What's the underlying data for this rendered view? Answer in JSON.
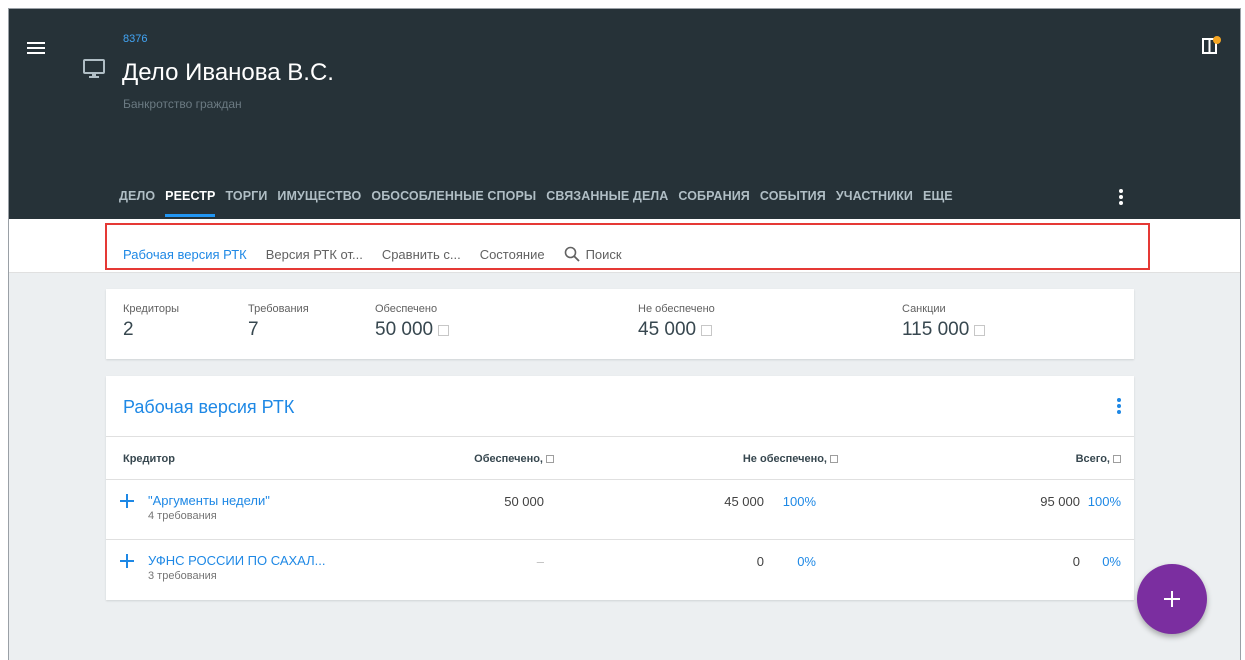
{
  "header": {
    "case_id": "8376",
    "title": "Дело Иванова В.С.",
    "subtitle": "Банкротство граждан",
    "menu_icon": "hamburger-menu-icon",
    "case_icon": "monitor-icon",
    "notification_icon": "notification-panel-icon",
    "accent_color": "#f5a623"
  },
  "tabs": [
    {
      "label": "ДЕЛО",
      "active": false
    },
    {
      "label": "РЕЕСТР",
      "active": true
    },
    {
      "label": "ТОРГИ",
      "active": false
    },
    {
      "label": "ИМУЩЕСТВО",
      "active": false
    },
    {
      "label": "ОБОСОБЛЕННЫЕ СПОРЫ",
      "active": false
    },
    {
      "label": "СВЯЗАННЫЕ ДЕЛА",
      "active": false
    },
    {
      "label": "СОБРАНИЯ",
      "active": false
    },
    {
      "label": "СОБЫТИЯ",
      "active": false
    },
    {
      "label": "УЧАСТНИКИ",
      "active": false
    },
    {
      "label": "ЕЩЕ",
      "active": false
    }
  ],
  "subnav": {
    "items": [
      "Рабочая версия РТК",
      "Версия РТК от...",
      "Сравнить с...",
      "Состояние"
    ],
    "search_label": "Поиск"
  },
  "stats": {
    "creditors_label": "Кредиторы",
    "creditors_value": "2",
    "claims_label": "Требования",
    "claims_value": "7",
    "secured_label": "Обеспечено",
    "secured_value": "50 000",
    "unsecured_label": "Не обеспечено",
    "unsecured_value": "45 000",
    "sanctions_label": "Санкции",
    "sanctions_value": "115 000"
  },
  "registry": {
    "title": "Рабочая версия РТК",
    "columns": {
      "creditor": "Кредитор",
      "secured": "Обеспечено,",
      "unsecured": "Не обеспечено,",
      "total": "Всего,"
    },
    "rows": [
      {
        "name": "\"Аргументы недели\"",
        "claims": "4 требования",
        "secured": "50 000",
        "unsecured": "45 000",
        "unsecured_pct": "100%",
        "total": "95 000",
        "total_pct": "100%"
      },
      {
        "name": "УФНС РОССИИ ПО САХАЛ...",
        "claims": "3 требования",
        "secured": "–",
        "unsecured": "0",
        "unsecured_pct": "0%",
        "total": "0",
        "total_pct": "0%"
      }
    ]
  },
  "fab": {
    "icon": "plus-icon",
    "color": "#7b2ea0"
  }
}
